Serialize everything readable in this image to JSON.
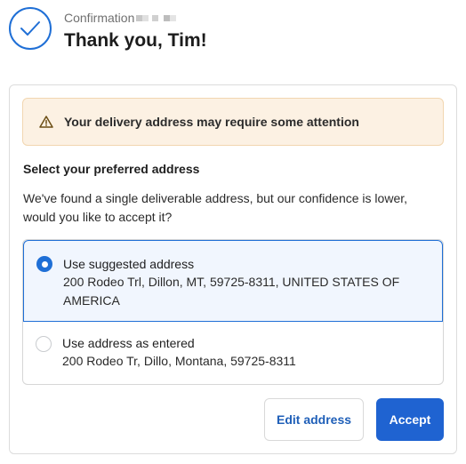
{
  "header": {
    "confirmation_label": "Confirmation",
    "thank_you": "Thank you, Tim!",
    "check_icon": "checkmark-icon"
  },
  "warning": {
    "icon": "warning-triangle-icon",
    "text": "Your delivery address may require some attention"
  },
  "section": {
    "title": "Select your preferred address",
    "description": "We've found a single deliverable address, but our confidence is lower, would you like to accept it?"
  },
  "options": [
    {
      "label": "Use suggested address",
      "address": "200 Rodeo Trl, Dillon, MT, 59725-8311, UNITED STATES OF AMERICA",
      "selected": true
    },
    {
      "label": "Use address as entered",
      "address": "200 Rodeo Tr, Dillo, Montana, 59725-8311",
      "selected": false
    }
  ],
  "buttons": {
    "edit": "Edit address",
    "accept": "Accept"
  },
  "colors": {
    "accent": "#1f63d1",
    "warning_bg": "#fcf1e3"
  }
}
